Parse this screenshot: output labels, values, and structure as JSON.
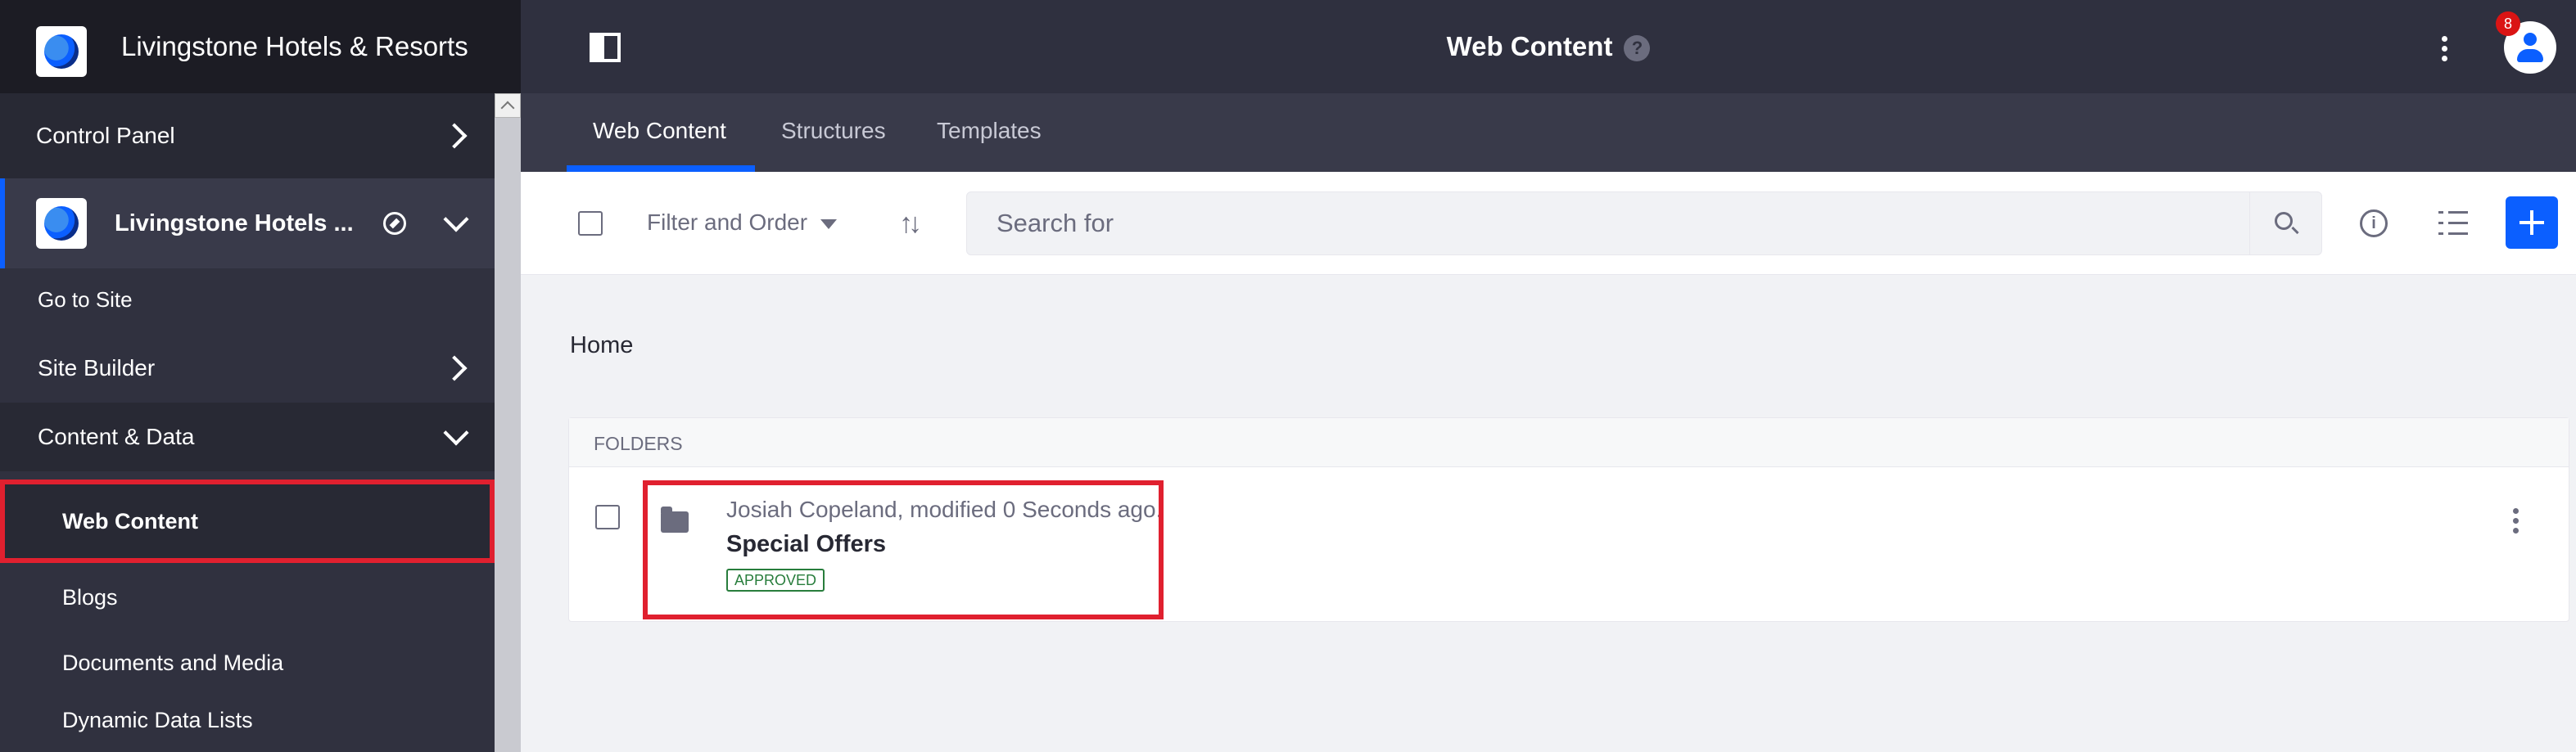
{
  "sidebar": {
    "company_name": "Livingstone Hotels & Resorts",
    "control_panel": "Control Panel",
    "site_name": "Livingstone Hotels ...",
    "go_to_site": "Go to Site",
    "site_builder": "Site Builder",
    "content_data": "Content & Data",
    "items": [
      {
        "label": "Web Content",
        "active": true
      },
      {
        "label": "Blogs"
      },
      {
        "label": "Documents and Media"
      },
      {
        "label": "Dynamic Data Lists"
      }
    ]
  },
  "header": {
    "title": "Web Content",
    "help_icon": "?",
    "notification_count": "8"
  },
  "tabs": [
    {
      "label": "Web Content",
      "active": true
    },
    {
      "label": "Structures"
    },
    {
      "label": "Templates"
    }
  ],
  "toolbar": {
    "filter_label": "Filter and Order",
    "search_placeholder": "Search for",
    "info_icon": "i"
  },
  "main": {
    "breadcrumb": "Home",
    "folders_header": "FOLDERS",
    "folder": {
      "meta": "Josiah Copeland, modified 0 Seconds ago.",
      "name": "Special Offers",
      "status": "APPROVED"
    }
  },
  "colors": {
    "accent": "#0b5fff",
    "highlight": "#e0202f",
    "approved": "#287d3c"
  }
}
